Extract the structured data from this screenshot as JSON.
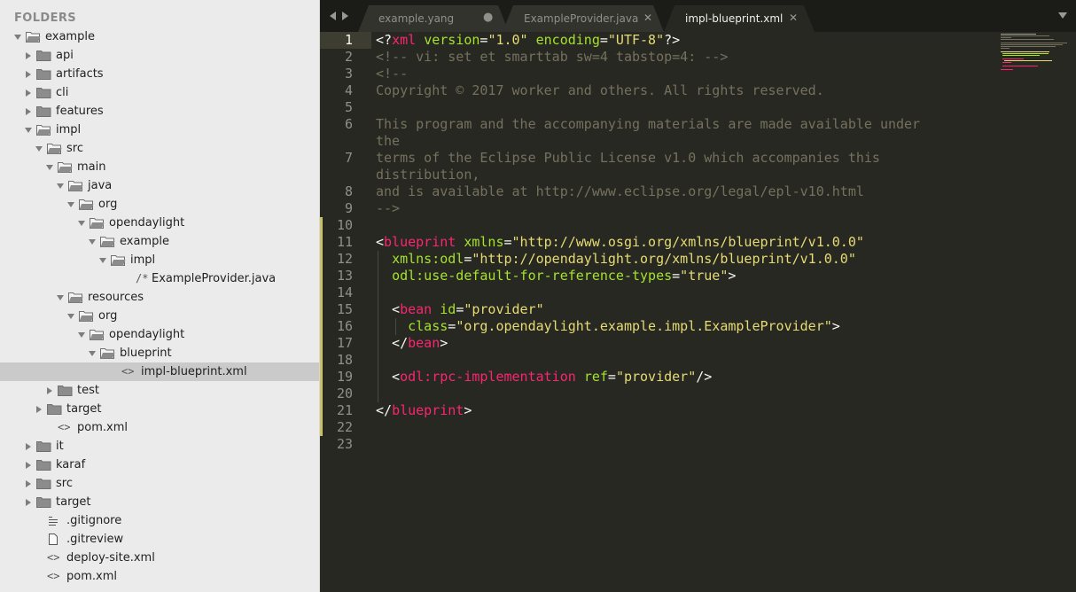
{
  "sidebar": {
    "title": "FOLDERS",
    "items": [
      {
        "label": "example",
        "depth": 0,
        "kind": "folder",
        "state": "open"
      },
      {
        "label": "api",
        "depth": 1,
        "kind": "folder",
        "state": "closed"
      },
      {
        "label": "artifacts",
        "depth": 1,
        "kind": "folder",
        "state": "closed"
      },
      {
        "label": "cli",
        "depth": 1,
        "kind": "folder",
        "state": "closed"
      },
      {
        "label": "features",
        "depth": 1,
        "kind": "folder",
        "state": "closed"
      },
      {
        "label": "impl",
        "depth": 1,
        "kind": "folder",
        "state": "open"
      },
      {
        "label": "src",
        "depth": 2,
        "kind": "folder",
        "state": "open"
      },
      {
        "label": "main",
        "depth": 3,
        "kind": "folder",
        "state": "open"
      },
      {
        "label": "java",
        "depth": 4,
        "kind": "folder",
        "state": "open"
      },
      {
        "label": "org",
        "depth": 5,
        "kind": "folder",
        "state": "open"
      },
      {
        "label": "opendaylight",
        "depth": 6,
        "kind": "folder",
        "state": "open"
      },
      {
        "label": "example",
        "depth": 7,
        "kind": "folder",
        "state": "open"
      },
      {
        "label": "impl",
        "depth": 8,
        "kind": "folder",
        "state": "open"
      },
      {
        "label": "ExampleProvider.java",
        "depth": 9,
        "kind": "java-file"
      },
      {
        "label": "resources",
        "depth": 4,
        "kind": "folder",
        "state": "open"
      },
      {
        "label": "org",
        "depth": 5,
        "kind": "folder",
        "state": "open"
      },
      {
        "label": "opendaylight",
        "depth": 6,
        "kind": "folder",
        "state": "open"
      },
      {
        "label": "blueprint",
        "depth": 7,
        "kind": "folder",
        "state": "open"
      },
      {
        "label": "impl-blueprint.xml",
        "depth": 8,
        "kind": "xml-file",
        "selected": true
      },
      {
        "label": "test",
        "depth": 3,
        "kind": "folder",
        "state": "closed"
      },
      {
        "label": "target",
        "depth": 2,
        "kind": "folder",
        "state": "closed"
      },
      {
        "label": "pom.xml",
        "depth": 2,
        "kind": "xml-file"
      },
      {
        "label": "it",
        "depth": 1,
        "kind": "folder",
        "state": "closed"
      },
      {
        "label": "karaf",
        "depth": 1,
        "kind": "folder",
        "state": "closed"
      },
      {
        "label": "src",
        "depth": 1,
        "kind": "folder",
        "state": "closed"
      },
      {
        "label": "target",
        "depth": 1,
        "kind": "folder",
        "state": "closed"
      },
      {
        "label": ".gitignore",
        "depth": 1,
        "kind": "text-file"
      },
      {
        "label": ".gitreview",
        "depth": 1,
        "kind": "plain-file"
      },
      {
        "label": "deploy-site.xml",
        "depth": 1,
        "kind": "xml-file"
      },
      {
        "label": "pom.xml",
        "depth": 1,
        "kind": "xml-file"
      }
    ]
  },
  "tabs": [
    {
      "label": "example.yang",
      "state": "modified"
    },
    {
      "label": "ExampleProvider.java",
      "state": "saved"
    },
    {
      "label": "impl-blueprint.xml",
      "state": "active"
    }
  ],
  "editor": {
    "current_line": "1",
    "lines": [
      {
        "n": "1",
        "tokens": [
          [
            "pun",
            "<?"
          ],
          [
            "tag",
            "xml"
          ],
          [
            "pun",
            " "
          ],
          [
            "attr",
            "version"
          ],
          [
            "pun",
            "="
          ],
          [
            "str",
            "\"1.0\""
          ],
          [
            "pun",
            " "
          ],
          [
            "attr",
            "encoding"
          ],
          [
            "pun",
            "="
          ],
          [
            "str",
            "\"UTF-8\""
          ],
          [
            "pun",
            "?>"
          ]
        ]
      },
      {
        "n": "2",
        "tokens": [
          [
            "com",
            "<!-- vi: set et smarttab sw=4 tabstop=4: -->"
          ]
        ]
      },
      {
        "n": "3",
        "tokens": [
          [
            "com",
            "<!--"
          ]
        ]
      },
      {
        "n": "4",
        "tokens": [
          [
            "com",
            "Copyright © 2017 worker and others. All rights reserved."
          ]
        ]
      },
      {
        "n": "5",
        "tokens": []
      },
      {
        "n": "6",
        "tokens": [
          [
            "com",
            "This program and the accompanying materials are made available under"
          ]
        ],
        "wrap": [
          [
            "com",
            "the"
          ]
        ]
      },
      {
        "n": "7",
        "tokens": [
          [
            "com",
            "terms of the Eclipse Public License v1.0 which accompanies this"
          ]
        ],
        "wrap": [
          [
            "com",
            "distribution,"
          ]
        ]
      },
      {
        "n": "8",
        "tokens": [
          [
            "com",
            "and is available at http://www.eclipse.org/legal/epl-v10.html"
          ]
        ]
      },
      {
        "n": "9",
        "tokens": [
          [
            "com",
            "-->"
          ]
        ]
      },
      {
        "n": "10",
        "tokens": []
      },
      {
        "n": "11",
        "tokens": [
          [
            "pun",
            "<"
          ],
          [
            "tag",
            "blueprint"
          ],
          [
            "pun",
            " "
          ],
          [
            "attr",
            "xmlns"
          ],
          [
            "pun",
            "="
          ],
          [
            "str",
            "\"http://www.osgi.org/xmlns/blueprint/v1.0.0\""
          ]
        ]
      },
      {
        "n": "12",
        "tokens": [
          [
            "pun",
            "  "
          ],
          [
            "attr",
            "xmlns:odl"
          ],
          [
            "pun",
            "="
          ],
          [
            "str",
            "\"http://opendaylight.org/xmlns/blueprint/v1.0.0\""
          ]
        ]
      },
      {
        "n": "13",
        "tokens": [
          [
            "pun",
            "  "
          ],
          [
            "attr",
            "odl:use-default-for-reference-types"
          ],
          [
            "pun",
            "="
          ],
          [
            "str",
            "\"true\""
          ],
          [
            "pun",
            ">"
          ]
        ]
      },
      {
        "n": "14",
        "tokens": []
      },
      {
        "n": "15",
        "tokens": [
          [
            "pun",
            "  <"
          ],
          [
            "tag",
            "bean"
          ],
          [
            "pun",
            " "
          ],
          [
            "attr",
            "id"
          ],
          [
            "pun",
            "="
          ],
          [
            "str",
            "\"provider\""
          ]
        ]
      },
      {
        "n": "16",
        "tokens": [
          [
            "pun",
            "    "
          ],
          [
            "attr",
            "class"
          ],
          [
            "pun",
            "="
          ],
          [
            "str",
            "\"org.opendaylight.example.impl.ExampleProvider\""
          ],
          [
            "pun",
            ">"
          ]
        ]
      },
      {
        "n": "17",
        "tokens": [
          [
            "pun",
            "  </"
          ],
          [
            "tag",
            "bean"
          ],
          [
            "pun",
            ">"
          ]
        ]
      },
      {
        "n": "18",
        "tokens": []
      },
      {
        "n": "19",
        "tokens": [
          [
            "pun",
            "  <"
          ],
          [
            "tag",
            "odl:rpc-implementation"
          ],
          [
            "pun",
            " "
          ],
          [
            "attr",
            "ref"
          ],
          [
            "pun",
            "="
          ],
          [
            "str",
            "\"provider\""
          ],
          [
            "pun",
            "/>"
          ]
        ]
      },
      {
        "n": "20",
        "tokens": []
      },
      {
        "n": "21",
        "tokens": [
          [
            "pun",
            "</"
          ],
          [
            "tag",
            "blueprint"
          ],
          [
            "pun",
            ">"
          ]
        ]
      },
      {
        "n": "22",
        "tokens": []
      },
      {
        "n": "23",
        "tokens": []
      }
    ]
  },
  "colors": {
    "sidebar_bg": "#ebebeb",
    "editor_bg": "#272822",
    "tag": "#f92672",
    "attr": "#a6e22e",
    "string": "#e6db74",
    "comment": "#75715e"
  }
}
